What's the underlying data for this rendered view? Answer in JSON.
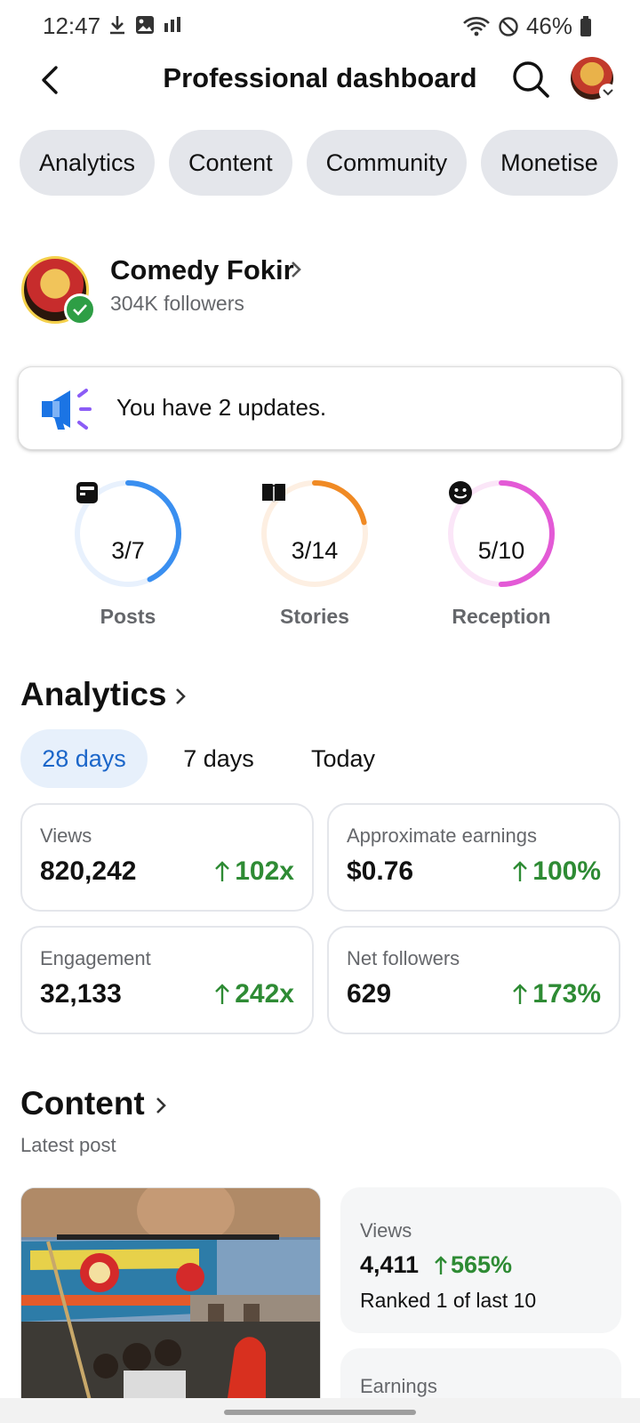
{
  "status_bar": {
    "time": "12:47",
    "battery": "46%",
    "icons": [
      "download-icon",
      "image-icon",
      "signal-icon",
      "wifi-icon",
      "do-not-disturb-icon",
      "battery-icon"
    ]
  },
  "header": {
    "title": "Professional dashboard"
  },
  "tabs": [
    {
      "label": "Analytics"
    },
    {
      "label": "Content"
    },
    {
      "label": "Community"
    },
    {
      "label": "Monetise"
    }
  ],
  "profile": {
    "name": "Comedy Fokir",
    "followers": "304K followers"
  },
  "updates": {
    "text": "You have 2 updates."
  },
  "rings": [
    {
      "value": "3/7",
      "label": "Posts",
      "fraction": 0.4286,
      "color": "#3a8ff0",
      "track": "#e8f1fd",
      "icon": "post-icon"
    },
    {
      "value": "3/14",
      "label": "Stories",
      "fraction": 0.2143,
      "color": "#f08a24",
      "track": "#fdefe2",
      "icon": "book-icon"
    },
    {
      "value": "5/10",
      "label": "Reception",
      "fraction": 0.5,
      "color": "#e35ad6",
      "track": "#fbe6f8",
      "icon": "smiley-icon"
    }
  ],
  "analytics": {
    "title": "Analytics",
    "periods": [
      {
        "label": "28 days",
        "active": true
      },
      {
        "label": "7 days",
        "active": false
      },
      {
        "label": "Today",
        "active": false
      }
    ],
    "stats": [
      {
        "label": "Views",
        "value": "820,242",
        "change": "102x"
      },
      {
        "label": "Approximate earnings",
        "value": "$0.76",
        "change": "100%"
      },
      {
        "label": "Engagement",
        "value": "32,133",
        "change": "242x"
      },
      {
        "label": "Net followers",
        "value": "629",
        "change": "173%"
      }
    ]
  },
  "content": {
    "title": "Content",
    "subtitle": "Latest post",
    "latest_post": {
      "views_label": "Views",
      "views_value": "4,411",
      "views_change": "565%",
      "rank": "Ranked 1 of last 10",
      "earnings_label": "Earnings"
    }
  },
  "colors": {
    "accent": "#1b66c9",
    "positive": "#2e8b34",
    "pill_bg": "#e4e6eb",
    "verified": "#2e9e45"
  }
}
